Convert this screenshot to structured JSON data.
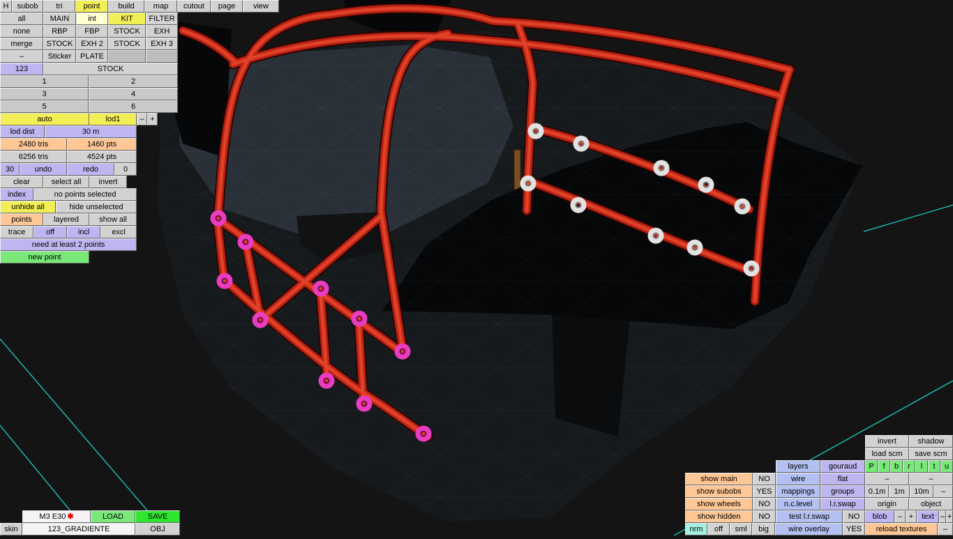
{
  "colors": {
    "accent_yellow": "#f2ee56",
    "accent_lavender": "#beb6f1",
    "accent_light_blue": "#b3c0f2",
    "accent_peach": "#ffc795",
    "accent_green": "#79e879",
    "accent_bright_green": "#2ee62e",
    "grid_cyan": "#1ae2d6",
    "cage_red": "#c22718",
    "point_magenta": "#ea3cc0",
    "point_white": "#e2e2e2"
  },
  "menu": {
    "h": "H",
    "items": [
      "subob",
      "tri",
      "point",
      "build",
      "map",
      "cutout",
      "page",
      "view"
    ],
    "active": "point"
  },
  "sub": {
    "rows": [
      [
        "all",
        "MAIN",
        "int",
        "KIT",
        "FILTER"
      ],
      [
        "none",
        "RBP",
        "FBP",
        "STOCK",
        "EXH"
      ],
      [
        "merge",
        "STOCK",
        "EXH 2",
        "STOCK",
        "EXH 3"
      ],
      [
        "–",
        "Sticker",
        "PLATE",
        "",
        ""
      ]
    ],
    "index": "123",
    "name": "STOCK",
    "slots": [
      "1",
      "2",
      "3",
      "4",
      "5",
      "6"
    ]
  },
  "lod": {
    "auto": "auto",
    "level": "lod1",
    "minus": "–",
    "plus": "+",
    "dist_label": "lod dist",
    "dist_value": "30 m",
    "sel_tris": "2480 tris",
    "sel_pts": "1460 pts",
    "total_tris": "6256 tris",
    "total_pts": "4524 pts",
    "undo_count": "30",
    "undo": "undo",
    "redo": "redo",
    "redo_count": "0"
  },
  "select": {
    "clear": "clear",
    "select_all": "select all",
    "invert": "invert",
    "index": "index",
    "status": "no points selected",
    "unhide_all": "unhide all",
    "hide_unselected": "hide unselected",
    "points": "points",
    "layered": "layered",
    "show_all": "show all",
    "trace": "trace",
    "off": "off",
    "incl": "incl",
    "excl": "excl",
    "message": "need at least 2 points",
    "new_point": "new point"
  },
  "file": {
    "model": "M3 E30",
    "dirty": "✱",
    "load": "LOAD",
    "save": "SAVE",
    "skin_label": "skin",
    "skin_value": "123_GRADIENTE",
    "obj": "OBJ"
  },
  "render": {
    "invert": "invert",
    "shadow": "shadow",
    "load_scm": "load scm",
    "save_scm": "save scm",
    "layers": "layers",
    "gouraud": "gouraud",
    "axes": [
      "P",
      "f",
      "b",
      "r",
      "l",
      "t",
      "u"
    ],
    "show_main": "show main",
    "show_main_val": "NO",
    "wire": "wire",
    "flat": "flat",
    "flat_dash_left": "–",
    "flat_dash_right": "–",
    "show_subobs": "show subobs",
    "show_subobs_val": "YES",
    "mappings": "mappings",
    "groups": "groups",
    "grid_01": "0.1m",
    "grid_1": "1m",
    "grid_10": "10m",
    "grid_dash": "–",
    "show_wheels": "show wheels",
    "show_wheels_val": "NO",
    "nc_level": "n.c.level",
    "lr_swap": "l.r.swap",
    "origin": "origin",
    "object": "object",
    "show_hidden": "show hidden",
    "show_hidden_val": "NO",
    "test_lr_swap": "test l.r.swap",
    "test_lr_swap_val": "NO",
    "blob": "blob",
    "blob_minus": "–",
    "blob_plus": "+",
    "text": "text",
    "text_minus": "–",
    "text_plus": "+",
    "nrm": "nrm",
    "off": "off",
    "sml": "sml",
    "big": "big",
    "wire_overlay": "wire overlay",
    "wire_overlay_val": "YES",
    "reload_textures": "reload textures",
    "reload_dash": "–"
  }
}
